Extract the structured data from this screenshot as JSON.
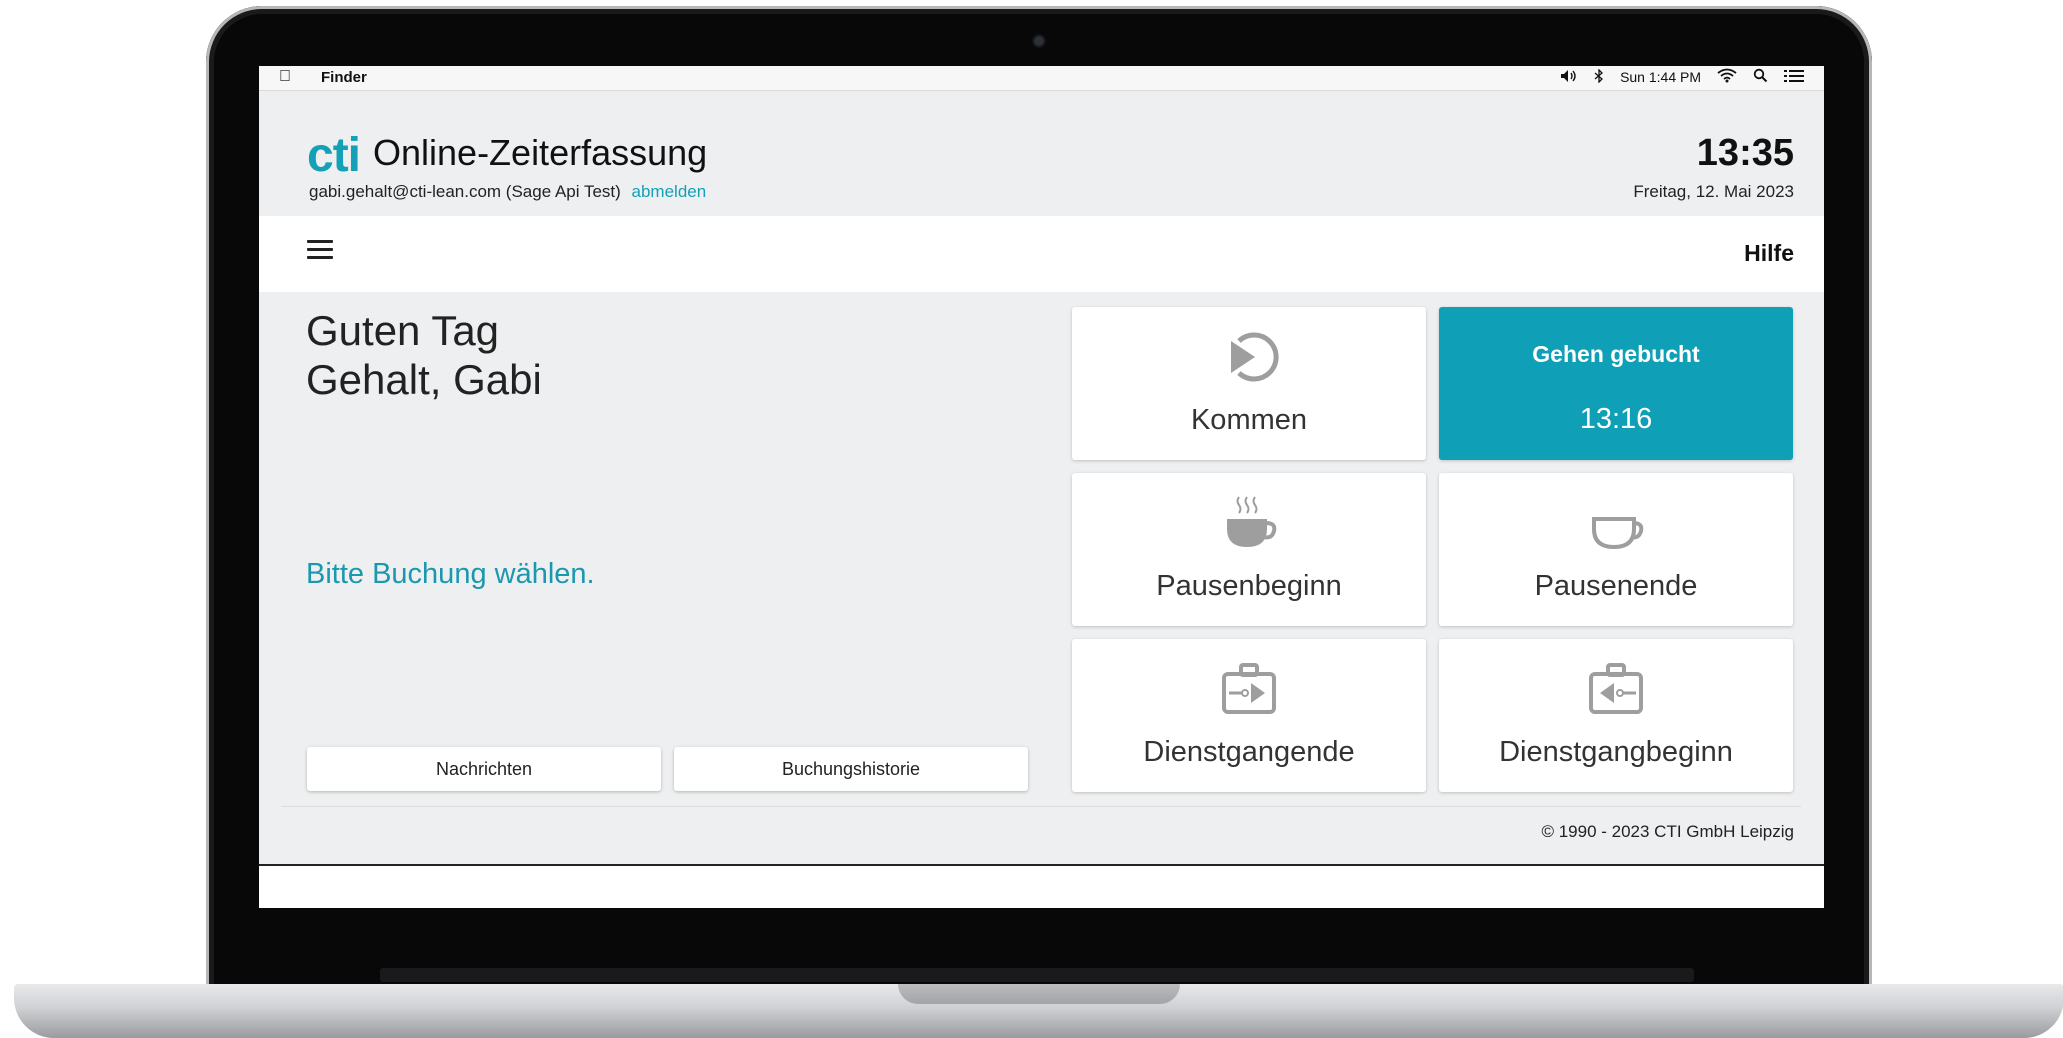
{
  "menubar": {
    "app_name": "Finder",
    "clock": "Sun 1:44 PM",
    "icons": [
      "apple-icon",
      "volume-icon",
      "bluetooth-icon",
      "wifi-icon",
      "spotlight-icon",
      "list-icon"
    ]
  },
  "header": {
    "logo": "cti",
    "title": "Online-Zeiterfassung",
    "user": "gabi.gehalt@cti-lean.com (Sage Api Test)",
    "logout": "abmelden",
    "time": "13:35",
    "date": "Freitag, 12. Mai 2023"
  },
  "nav": {
    "help": "Hilfe"
  },
  "greeting": {
    "line1": "Guten Tag",
    "line2": "Gehalt, Gabi",
    "prompt": "Bitte Buchung wählen."
  },
  "buttons": {
    "messages": "Nachrichten",
    "history": "Buchungshistorie"
  },
  "tiles": {
    "kommen": "Kommen",
    "gehen_status": "Gehen gebucht",
    "gehen_time": "13:16",
    "pausenbeginn": "Pausenbeginn",
    "pausenende": "Pausenende",
    "dienstgangende": "Dienstgangende",
    "dienstgangbeginn": "Dienstgangbeginn"
  },
  "footer": {
    "copyright": "© 1990 - 2023 CTI GmbH Leipzig"
  },
  "colors": {
    "accent": "#0f9fb6",
    "background": "#eeeff0",
    "icon_gray": "#9e9e9e"
  }
}
